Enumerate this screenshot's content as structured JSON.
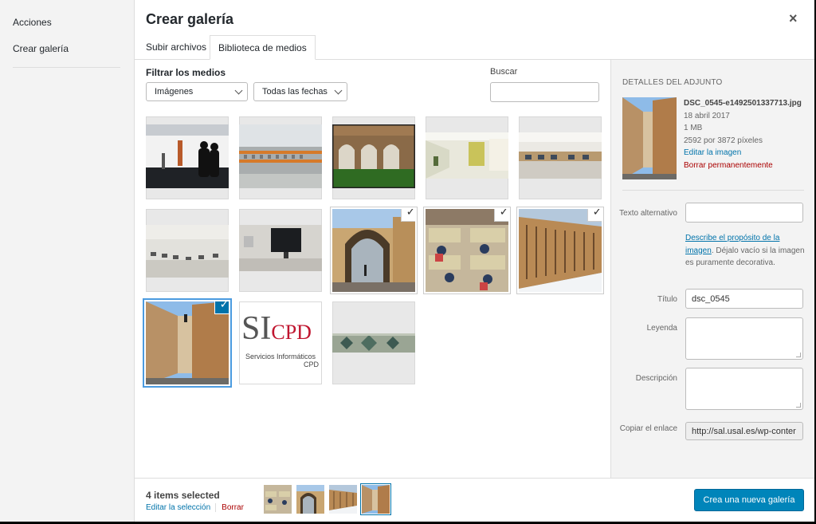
{
  "menu": {
    "actions_label": "Acciones",
    "active_label": "Crear galería"
  },
  "header": {
    "title": "Crear galería",
    "close_glyph": "×"
  },
  "tabs": [
    {
      "label": "Subir archivos"
    },
    {
      "label": "Biblioteca de medios"
    }
  ],
  "filters": {
    "label": "Filtrar los medios",
    "type_selected": "Imágenes",
    "date_selected": "Todas las fechas",
    "search_label": "Buscar",
    "search_value": ""
  },
  "grid": [
    {
      "subject": "people silhouettes by glass",
      "selected": false
    },
    {
      "subject": "modern building facade",
      "selected": false
    },
    {
      "subject": "cloister courtyard",
      "selected": false
    },
    {
      "subject": "corridor interior",
      "selected": false
    },
    {
      "subject": "computer lab",
      "selected": false
    },
    {
      "subject": "empty computer room",
      "selected": false
    },
    {
      "subject": "monitor on desk",
      "selected": false
    },
    {
      "subject": "stone arch street",
      "selected": true,
      "check": "✓"
    },
    {
      "subject": "students studying",
      "selected": true,
      "check": "✓"
    },
    {
      "subject": "sandstone building snow",
      "selected": true,
      "check": "✓"
    },
    {
      "subject": "narrow stone street",
      "selected": true,
      "focused": true,
      "check": "✓"
    },
    {
      "subject": "SICPD logo",
      "selected": false
    },
    {
      "subject": "mosaic banner",
      "selected": false
    }
  ],
  "logo": {
    "text_si": "SI",
    "text_cpd": "CPD",
    "line1": "Servicios Informáticos",
    "line2": "CPD"
  },
  "details": {
    "heading": "DETALLES DEL ADJUNTO",
    "filename": "DSC_0545-e1492501337713.jpg",
    "date": "18 abril 2017",
    "size": "1 MB",
    "dimensions": "2592 por 3872 píxeles",
    "edit_link": "Editar la imagen",
    "delete_link": "Borrar permanentemente",
    "alt_label": "Texto alternativo",
    "alt_value": "",
    "alt_help_link": "Describe el propósito de la imagen",
    "alt_help_rest": ". Déjalo vacío si la imagen es puramente decorativa.",
    "title_label": "Título",
    "title_value": "dsc_0545",
    "caption_label": "Leyenda",
    "caption_value": "",
    "description_label": "Descripción",
    "description_value": "",
    "copy_label": "Copiar el enlace",
    "copy_value": "http://sal.usal.es/wp-conter"
  },
  "toolbar": {
    "count": "4 items selected",
    "edit_selection": "Editar la selección",
    "clear": "Borrar",
    "create_button": "Crea una nueva galería"
  },
  "colors": {
    "primary": "#0085ba",
    "link": "#0073aa",
    "danger": "#a00000",
    "selection": "#4b9be0"
  }
}
